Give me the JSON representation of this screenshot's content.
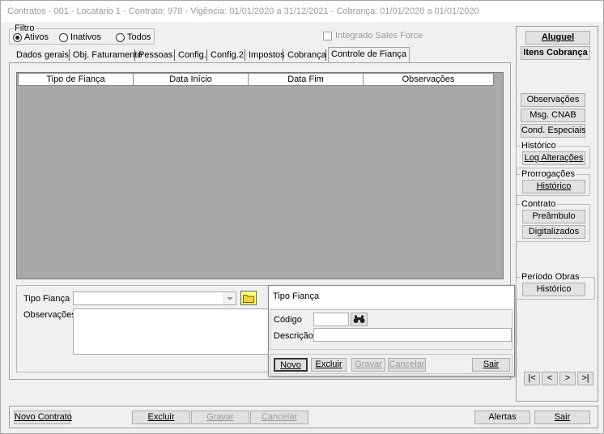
{
  "window": {
    "title": "Contratos - 001 - Locatario 1 - Contrato: 978 - Vigência: 01/01/2020 a 31/12/2021 - Cobrança: 01/01/2020 a 01/01/2020"
  },
  "filter": {
    "legend": "Filtro",
    "options": [
      "Ativos",
      "Inativos",
      "Todos"
    ],
    "selected": "Ativos",
    "integrado_label": "Integrado Sales Force"
  },
  "tabs": [
    "Dados gerais",
    "Obj. Faturamento",
    "Pessoas",
    "Config.",
    "Config.2",
    "Impostos",
    "Cobrança",
    "Controle de Fiança"
  ],
  "active_tab": "Controle de Fiança",
  "grid": {
    "columns": [
      "Tipo de Fiança",
      "Data Início",
      "Data Fim",
      "Observações"
    ]
  },
  "form": {
    "tipo_fianca_label": "Tipo Fiança",
    "observacoes_label": "Observações"
  },
  "popup": {
    "title": "Tipo Fiança",
    "codigo_label": "Código",
    "descricao_label": "Descrição",
    "buttons": {
      "novo": "Novo",
      "excluir": "Excluir",
      "gravar": "Gravar",
      "cancelar": "Cancelar",
      "sair": "Sair"
    }
  },
  "right_panel": {
    "aluguel": "Aluguel",
    "itens_cobranca": "Itens Cobrança",
    "observacoes": "Observações",
    "msg_cnab": "Msg. CNAB",
    "cond_especiais": "Cond. Especiais",
    "historico_legend": "Histórico",
    "log_alteracoes": "Log Alterações",
    "prorrogacoes_legend": "Prorrogações",
    "prorrogacoes_historico": "Histórico",
    "contrato_legend": "Contrato",
    "preambulo": "Preâmbulo",
    "digitalizados": "Digitalizados",
    "periodo_obras_legend": "Período Obras",
    "periodo_obras_historico": "Histórico",
    "nav": [
      "|<",
      "<",
      ">",
      ">|"
    ]
  },
  "bottom_bar": {
    "novo_contrato": "Novo Contrato",
    "excluir": "Excluir",
    "gravar": "Gravar",
    "cancelar": "Cancelar",
    "alertas": "Alertas",
    "sair": "Sair"
  },
  "colors": {
    "grid_bg": "#a9a9a9",
    "folder_icon": "#f5d442",
    "annotation_arrow": "#e00000"
  }
}
